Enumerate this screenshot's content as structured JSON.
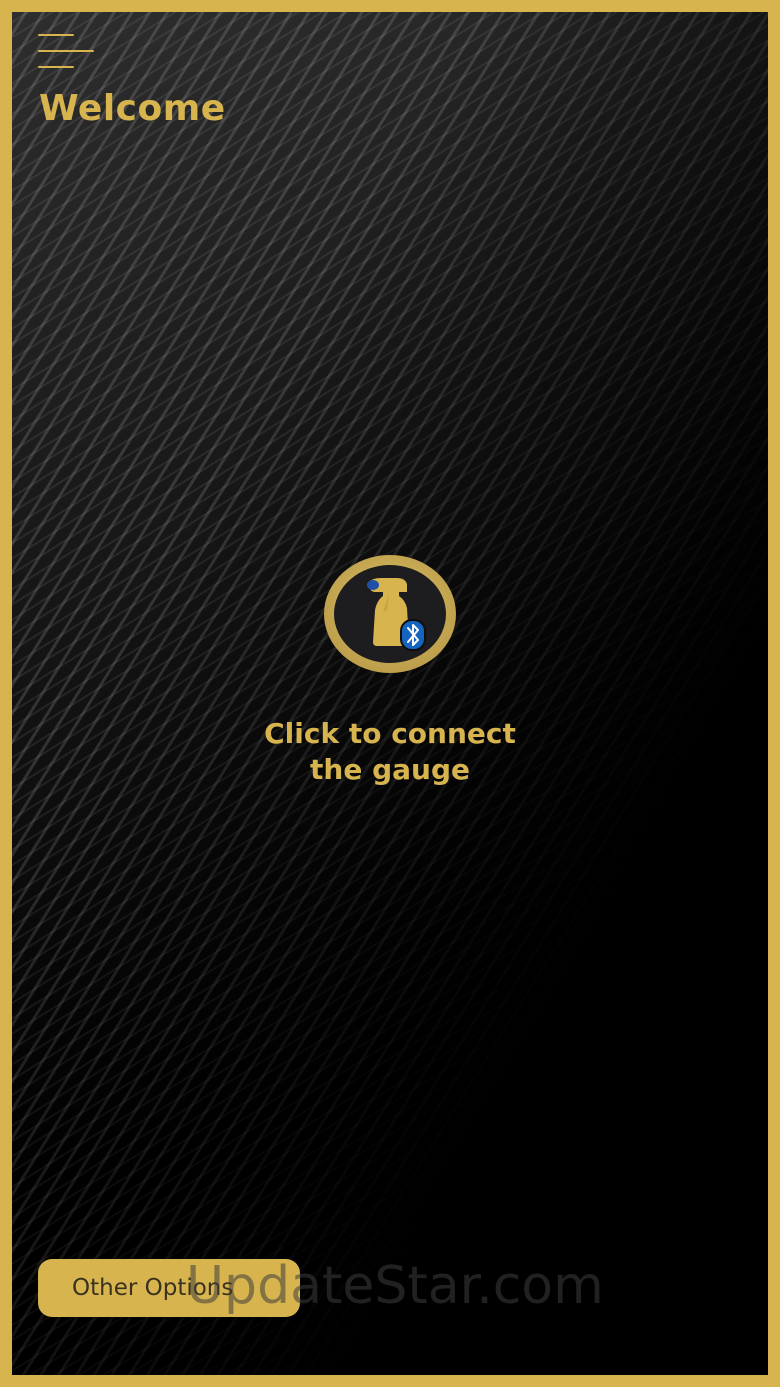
{
  "header": {
    "title": "Welcome",
    "menu_icon": "hamburger-menu-icon"
  },
  "connect": {
    "icon": "spray-bottle-bluetooth-icon",
    "label_line1": "Click to connect",
    "label_line2": "the gauge"
  },
  "footer": {
    "other_options_label": "Other Options"
  },
  "watermark": {
    "text": "UpdateStar.com"
  },
  "colors": {
    "accent_gold": "#D7B44E",
    "background": "#000000",
    "bluetooth_blue": "#1565C0"
  }
}
